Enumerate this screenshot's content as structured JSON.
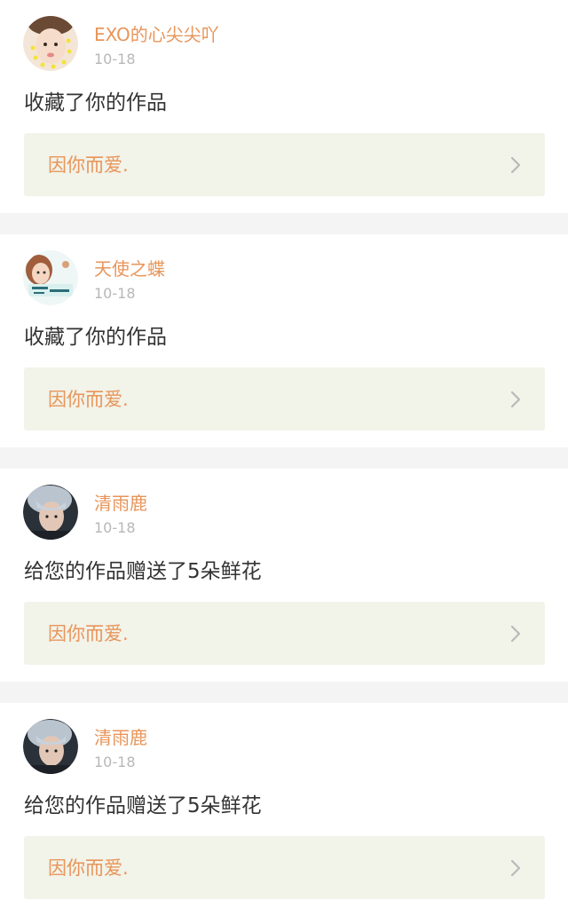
{
  "colors": {
    "accent": "#e8955a",
    "muted": "#b7b7b7",
    "text": "#333333",
    "link_bg": "#f2f3e9",
    "page_bg": "#f4f4f4"
  },
  "notifications": [
    {
      "username": "EXO的心尖尖吖",
      "time": "10-18",
      "action": "收藏了你的作品",
      "work_title": "因你而爱.",
      "avatar": "avatar-girl-face",
      "chevron": "chevron-right-icon"
    },
    {
      "username": "天使之蝶",
      "time": "10-18",
      "action": "收藏了你的作品",
      "work_title": "因你而爱.",
      "avatar": "avatar-anime-girl",
      "chevron": "chevron-right-icon"
    },
    {
      "username": "清雨鹿",
      "time": "10-18",
      "action": "给您的作品赠送了5朵鲜花",
      "work_title": "因你而爱.",
      "avatar": "avatar-grey-hair-boy",
      "chevron": "chevron-right-icon"
    },
    {
      "username": "清雨鹿",
      "time": "10-18",
      "action": "给您的作品赠送了5朵鲜花",
      "work_title": "因你而爱.",
      "avatar": "avatar-grey-hair-boy",
      "chevron": "chevron-right-icon"
    }
  ]
}
